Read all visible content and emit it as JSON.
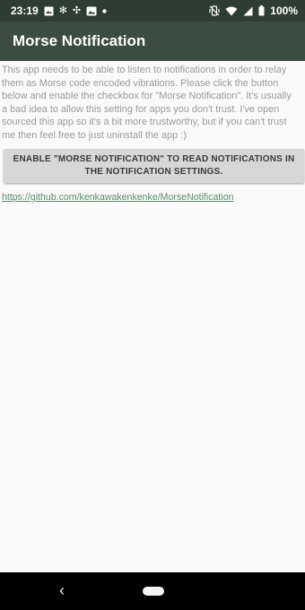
{
  "status_bar": {
    "time": "23:19",
    "battery_percent": "100%",
    "left_icons": [
      "image-icon",
      "settings-icon",
      "sync-icon",
      "photo-icon",
      "notification-dot-icon"
    ],
    "right_icons": [
      "vibrate-icon",
      "wifi-icon",
      "signal-icon",
      "battery-icon"
    ]
  },
  "app_bar": {
    "title": "Morse Notification"
  },
  "main": {
    "description": "This app needs to be able to listen to notifications in order to relay them as Morse code encoded vibrations. Please click the button below and enable the checkbox for \"Morse Notification\". It's usually a bad idea to allow this setting for apps you don't trust. I've open sourced this app so it's a bit more trustworthy, but if you can't trust me then feel free to just uninstall the app :)",
    "enable_button_label": "ENABLE \"MORSE NOTIFICATION\" TO READ NOTIFICATIONS IN THE NOTIFICATION SETTINGS.",
    "repo_link": "https://github.com/kenkawakenkenke/MorseNotification"
  },
  "nav_bar": {
    "back_glyph": "‹"
  },
  "colors": {
    "status_bar_bg": "#2e3d33",
    "app_bar_bg": "#3b4c40",
    "link": "#5f8a6e",
    "button_bg": "#d7d7d7"
  }
}
